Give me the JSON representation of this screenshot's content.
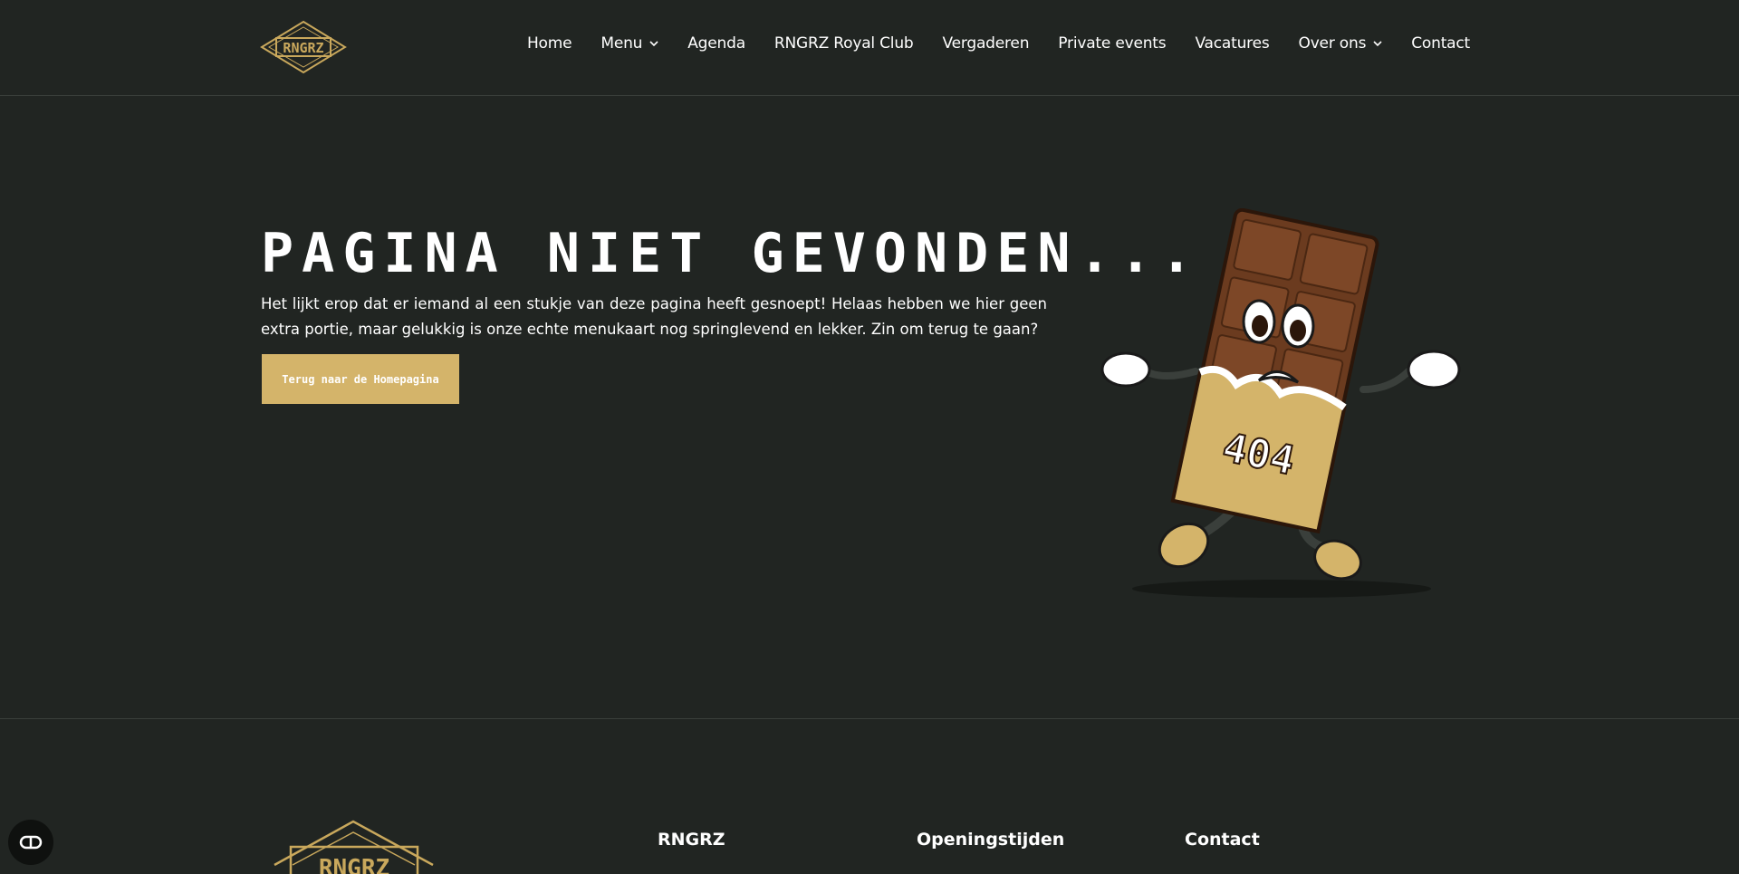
{
  "header": {
    "logo_text": "RNGRZ",
    "nav": [
      {
        "label": "Home",
        "has_dropdown": false
      },
      {
        "label": "Menu",
        "has_dropdown": true
      },
      {
        "label": "Agenda",
        "has_dropdown": false
      },
      {
        "label": "RNGRZ Royal Club",
        "has_dropdown": false
      },
      {
        "label": "Vergaderen",
        "has_dropdown": false
      },
      {
        "label": "Private events",
        "has_dropdown": false
      },
      {
        "label": "Vacatures",
        "has_dropdown": false
      },
      {
        "label": "Over ons",
        "has_dropdown": true
      },
      {
        "label": "Contact",
        "has_dropdown": false
      }
    ]
  },
  "hero": {
    "title": "PAGINA NIET GEVONDEN...",
    "text": "Het lijkt erop dat er iemand al een stukje van deze pagina heeft gesnoept! Helaas hebben we hier geen extra portie, maar gelukkig is onze echte menukaart nog springlevend en lekker. Zin om terug te gaan?",
    "button_label": "Terug naar de Homepagina",
    "mascot_label": "404"
  },
  "footer": {
    "logo_text": "RNGRZ",
    "headings": [
      "RNGRZ",
      "Openingstijden",
      "Contact"
    ]
  },
  "colors": {
    "background": "#212522",
    "accent": "#d4b46a",
    "text": "#ffffff"
  },
  "icons": {
    "accessibility": "accessibility-icon",
    "dropdown": "chevron-down-icon"
  }
}
